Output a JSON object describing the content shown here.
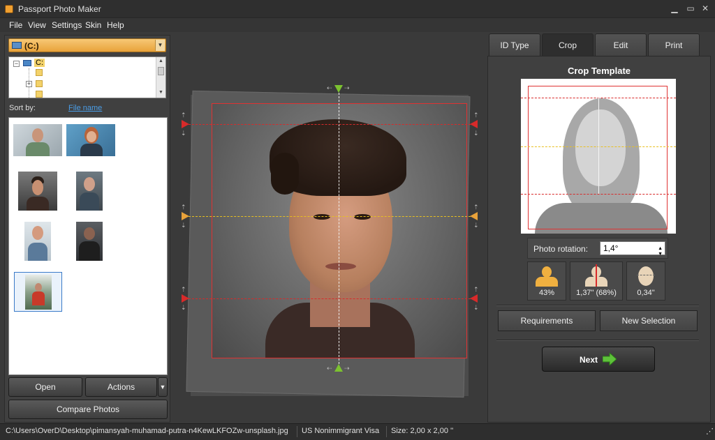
{
  "window": {
    "title": "Passport Photo Maker"
  },
  "menu": [
    "File",
    "View",
    "Settings",
    "Skin",
    "Help"
  ],
  "left": {
    "drive": "(C:)",
    "tree_root": "C:",
    "sort_label": "Sort by:",
    "sort_value": "File name",
    "open": "Open",
    "actions": "Actions",
    "compare": "Compare Photos"
  },
  "tabs": [
    "ID Type",
    "Crop",
    "Edit",
    "Print"
  ],
  "active_tab": "Crop",
  "crop": {
    "template_title": "Crop Template",
    "rotation_label": "Photo rotation:",
    "rotation_value": "1,4°",
    "stats": [
      "43%",
      "1,37\" (68%)",
      "0,34\""
    ],
    "requirements": "Requirements",
    "new_selection": "New Selection",
    "next": "Next"
  },
  "status": {
    "path": "C:\\Users\\OverD\\Desktop\\pimansyah-muhamad-putra-n4KewLKFOZw-unsplash.jpg",
    "visa": "US Nonimmigrant Visa",
    "size": "Size: 2,00 x 2,00 ''"
  },
  "colors": {
    "accent": "#e8a23a",
    "guide_red": "#d82a2a",
    "guide_yellow": "#e8c020",
    "marker_green": "#7cc230"
  },
  "icons": [
    "minimize-icon",
    "maximize-icon",
    "close-icon",
    "head-size-icon",
    "eye-height-icon",
    "face-width-icon",
    "arrow-right-icon"
  ]
}
